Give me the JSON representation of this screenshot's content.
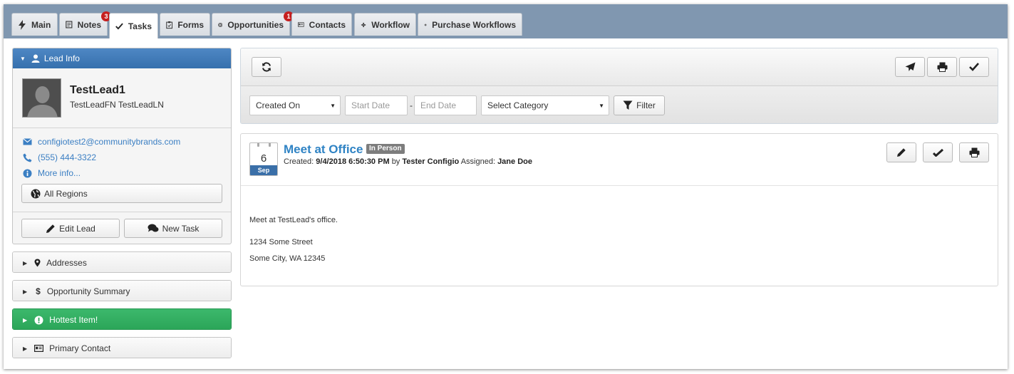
{
  "tabs": [
    {
      "label": "Main",
      "icon": "bolt-icon"
    },
    {
      "label": "Notes",
      "icon": "notes-icon",
      "badge": "3"
    },
    {
      "label": "Tasks",
      "icon": "check-icon",
      "active": true
    },
    {
      "label": "Forms",
      "icon": "clipboard-icon"
    },
    {
      "label": "Opportunities",
      "icon": "target-icon",
      "badge": "1"
    },
    {
      "label": "Contacts",
      "icon": "id-card-icon"
    },
    {
      "label": "Workflow",
      "icon": "workflow-icon"
    },
    {
      "label": "Purchase Workflows",
      "icon": "workflow-icon"
    }
  ],
  "lead": {
    "header": "Lead Info",
    "name": "TestLead1",
    "full_name": "TestLeadFN TestLeadLN",
    "email": "configiotest2@communitybrands.com",
    "phone": "(555) 444-3322",
    "more_info": "More info...",
    "regions_button": "All Regions",
    "edit_button": "Edit Lead",
    "new_task_button": "New Task"
  },
  "sections": {
    "addresses": "Addresses",
    "opportunity_summary": "Opportunity Summary",
    "hottest_item": "Hottest Item!",
    "primary_contact": "Primary Contact"
  },
  "filters": {
    "sort_select": "Created On",
    "start_date_placeholder": "Start Date",
    "separator": "-",
    "end_date_placeholder": "End Date",
    "category_select": "Select Category",
    "filter_button": "Filter"
  },
  "task": {
    "day": "6",
    "month": "Sep",
    "title": "Meet at Office",
    "type_badge": "In Person",
    "created_label": "Created:",
    "created_datetime": "9/4/2018 6:50:30 PM",
    "by_label": "by",
    "created_by": "Tester Configio",
    "assigned_label": "Assigned:",
    "assigned_to": "Jane Doe",
    "body_line1": "Meet at TestLead's office.",
    "body_line2": "1234 Some Street",
    "body_line3": "Some City, WA 12345"
  },
  "colors": {
    "tabbar": "#8097b0",
    "lead_header": "#3670ad",
    "link": "#3b7fc3",
    "hottest": "#2aa457",
    "badge": "#c61f1f"
  }
}
